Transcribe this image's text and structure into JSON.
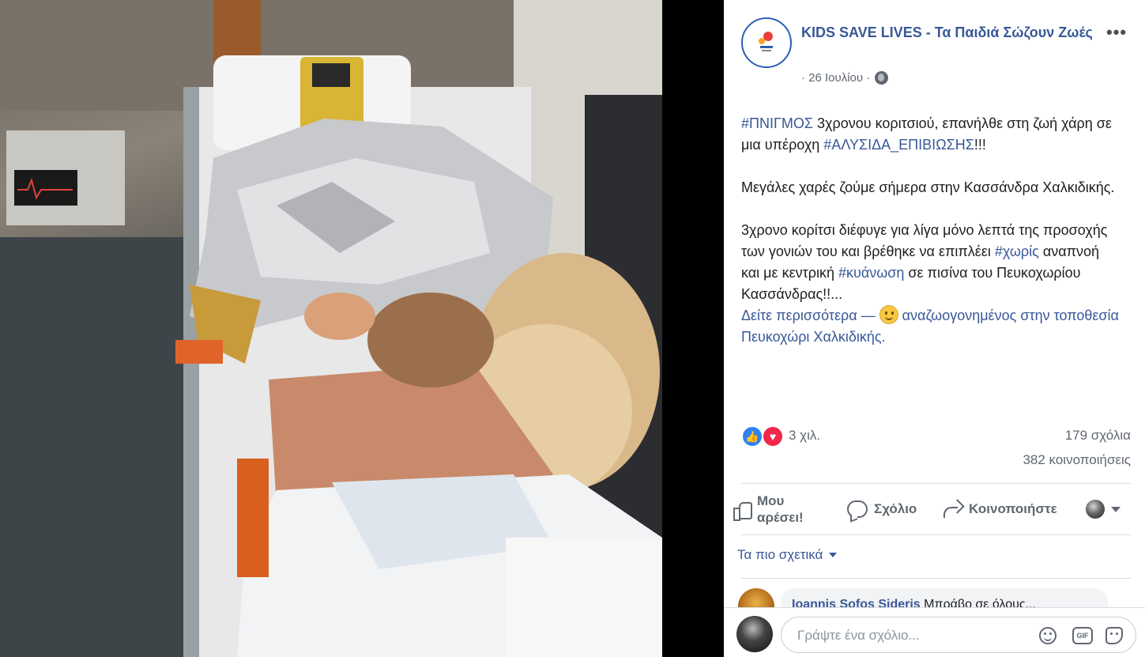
{
  "post": {
    "page_name": "KIDS SAVE LIVES - Τα Παιδιά Σώζουν Ζωές",
    "more": "•••",
    "date": "· 26 Ιουλίου ·",
    "paragraph1": {
      "tag1": "#ΠΝΙΓΜΟΣ",
      "text1": " 3χρονου κοριτσιού, επανήλθε στη ζωή χάρη σε μια υπέροχη ",
      "tag2": "#ΑΛΥΣΙΔΑ_ΕΠΙΒΙΩΣΗΣ",
      "text2": "!!!"
    },
    "paragraph2": "Μεγάλες χαρές ζούμε σήμερα στην Κασσάνδρα Χαλκιδικής.",
    "paragraph3": {
      "text1": "3χρονο κορίτσι διέφυγε για λίγα μόνο λεπτά της προσοχής των γονιών του και βρέθηκε να επιπλέει ",
      "tag1": "#χωρίς",
      "text2": " αναπνοή και με κεντρική ",
      "tag2": "#κυάνωση",
      "text3": " σε πισίνα του Πευκοχωρίου Κασσάνδρας!!...",
      "see_more": "Δείτε περισσότερα",
      "dash": " — ",
      "feeling": " αναζωογονημένος στην τοποθεσία ",
      "location": "Πευκοχώρι Χαλκιδικής",
      "end": "."
    }
  },
  "stats": {
    "reactions": "3 χιλ.",
    "comments": "179 σχόλια",
    "shares": "382 κοινοποιήσεις"
  },
  "actions": {
    "like": "Μου αρέσει!",
    "comment": "Σχόλιο",
    "share": "Κοινοποιήστε"
  },
  "sort": {
    "label": "Τα πιο σχετικά"
  },
  "comment_preview": {
    "author": "Ioannis Sofos Sideris",
    "text": " Μπράβο σε όλους..."
  },
  "composer": {
    "placeholder": "Γράψτε ένα σχόλιο...",
    "gif": "GIF"
  },
  "colors": {
    "link": "#385898",
    "like_blue": "#2d82f7",
    "love_red": "#f0284a"
  },
  "icons": [
    "more-icon",
    "globe-icon",
    "like-icon",
    "love-icon",
    "smile-icon",
    "thumb-icon",
    "bubble-icon",
    "share-icon",
    "caret-icon",
    "emoji-icon",
    "gif-icon",
    "sticker-icon"
  ]
}
